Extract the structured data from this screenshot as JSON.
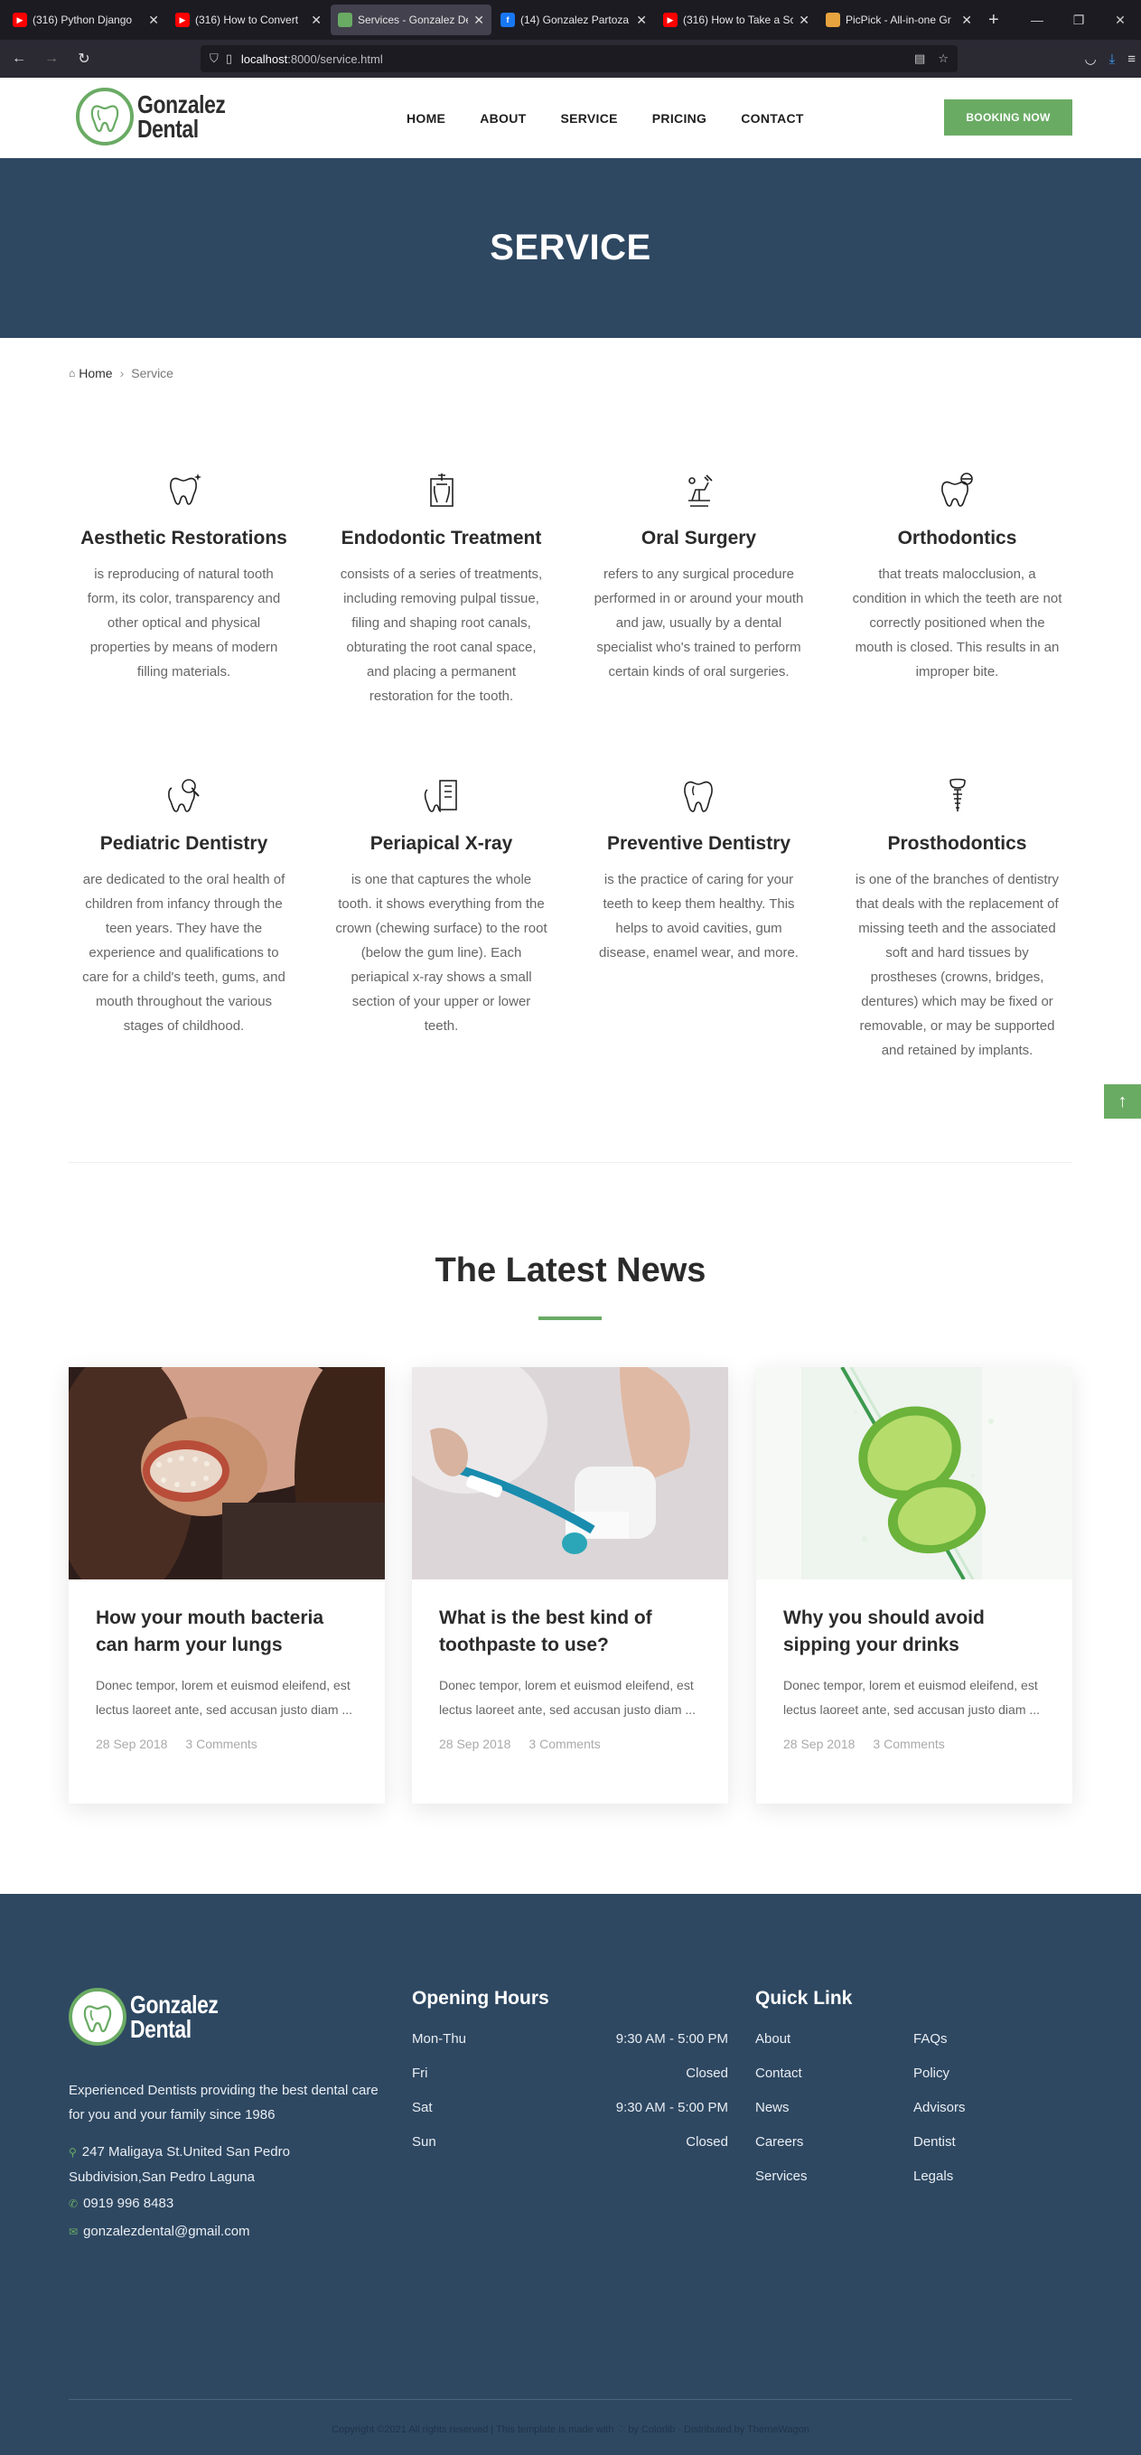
{
  "browser": {
    "tabs": [
      {
        "title": "(316) Python Django",
        "icon": "youtube-icon",
        "color": "#ff0000"
      },
      {
        "title": "(316) How to Convert",
        "icon": "youtube-icon",
        "color": "#ff0000"
      },
      {
        "title": "Services - Gonzalez De",
        "icon": "site-icon",
        "color": "#6aab64"
      },
      {
        "title": "(14) Gonzalez Partoza",
        "icon": "facebook-icon",
        "color": "#1877f2"
      },
      {
        "title": "(316) How to Take a Sc",
        "icon": "youtube-icon",
        "color": "#ff0000"
      },
      {
        "title": "PicPick - All-in-one Gr",
        "icon": "picpick-icon",
        "color": "#e7a33e"
      }
    ],
    "url_host": "localhost",
    "url_path": ":8000/service.html"
  },
  "header": {
    "logo_line1": "Gonzalez",
    "logo_line2": "Dental",
    "menu": [
      "HOME",
      "ABOUT",
      "SERVICE",
      "PRICING",
      "CONTACT"
    ],
    "booking_label": "BOOKING NOW"
  },
  "hero": {
    "title": "SERVICE"
  },
  "breadcrumb": {
    "home": "Home",
    "current": "Service"
  },
  "services": [
    {
      "title": "Aesthetic Restorations",
      "text": "is reproducing of natural tooth form, its color, transparency and other optical and physical properties by means of modern filling materials.",
      "icon": "sparkle-tooth-icon"
    },
    {
      "title": "Endodontic Treatment",
      "text": "consists of a series of treatments, including removing pulpal tissue, filing and shaping root canals, obturating the root canal space, and placing a permanent restoration for the tooth.",
      "icon": "tooth-root-icon"
    },
    {
      "title": "Oral Surgery",
      "text": "refers to any surgical procedure performed in or around your mouth and jaw, usually by a dental specialist who's trained to perform certain kinds of oral surgeries.",
      "icon": "dental-chair-icon"
    },
    {
      "title": "Orthodontics",
      "text": "that treats malocclusion, a condition in which the teeth are not correctly positioned when the mouth is closed. This results in an improper bite.",
      "icon": "braces-tooth-icon"
    },
    {
      "title": "Pediatric Dentistry",
      "text": "are dedicated to the oral health of children from infancy through the teen years. They have the experience and qualifications to care for a child's teeth, gums, and mouth throughout the various stages of childhood.",
      "icon": "tooth-magnifier-icon"
    },
    {
      "title": "Periapical X-ray",
      "text": "is one that captures the whole tooth. it shows everything from the crown (chewing surface) to the root (below the gum line). Each periapical x-ray shows a small section of your upper or lower teeth.",
      "icon": "tooth-clipboard-icon"
    },
    {
      "title": "Preventive Dentistry",
      "text": "is the practice of caring for your teeth to keep them healthy. This helps to avoid cavities, gum disease, enamel wear, and more.",
      "icon": "tooth-icon"
    },
    {
      "title": "Prosthodontics",
      "text": "is one of the branches of dentistry that deals with the replacement of missing teeth and the associated soft and hard tissues by prostheses (crowns, bridges, dentures) which may be fixed or removable, or may be supported and retained by implants.",
      "icon": "implant-icon"
    }
  ],
  "news": {
    "title": "The Latest News",
    "accent": "#6aab64",
    "posts": [
      {
        "title": "How your mouth bacteria can harm your lungs",
        "excerpt": "Donec tempor, lorem et euismod eleifend, est lectus laoreet ante, sed accusan justo diam ...",
        "date": "28 Sep 2018",
        "comments": "3 Comments"
      },
      {
        "title": "What is the best kind of toothpaste to use?",
        "excerpt": "Donec tempor, lorem et euismod eleifend, est lectus laoreet ante, sed accusan justo diam ...",
        "date": "28 Sep 2018",
        "comments": "3 Comments"
      },
      {
        "title": "Why you should avoid sipping your drinks",
        "excerpt": "Donec tempor, lorem et euismod eleifend, est lectus laoreet ante, sed accusan justo diam ...",
        "date": "28 Sep 2018",
        "comments": "3 Comments"
      }
    ]
  },
  "footer": {
    "logo_line1": "Gonzalez",
    "logo_line2": "Dental",
    "about": "Experienced Dentists providing the best dental care for you and your family since 1986",
    "address": "247 Maligaya St.United San Pedro Subdivision,San Pedro Laguna",
    "phone": "0919 996 8483",
    "email": "gonzalezdental@gmail.com",
    "hours_title": "Opening Hours",
    "hours": [
      {
        "day": "Mon-Thu",
        "time": "9:30 AM - 5:00 PM"
      },
      {
        "day": "Fri",
        "time": "Closed"
      },
      {
        "day": "Sat",
        "time": "9:30 AM - 5:00 PM"
      },
      {
        "day": "Sun",
        "time": "Closed"
      }
    ],
    "quick_title": "Quick Link",
    "links_col1": [
      "About",
      "Contact",
      "News",
      "Careers",
      "Services"
    ],
    "links_col2": [
      "FAQs",
      "Policy",
      "Advisors",
      "Dentist",
      "Legals"
    ],
    "copyright": "Copyright ©2021 All rights reserved | This template is made with ♡ by Colorlib · Distributed by ThemeWagon"
  },
  "colors": {
    "brand": "#6aab64",
    "navy": "#2e4862"
  }
}
